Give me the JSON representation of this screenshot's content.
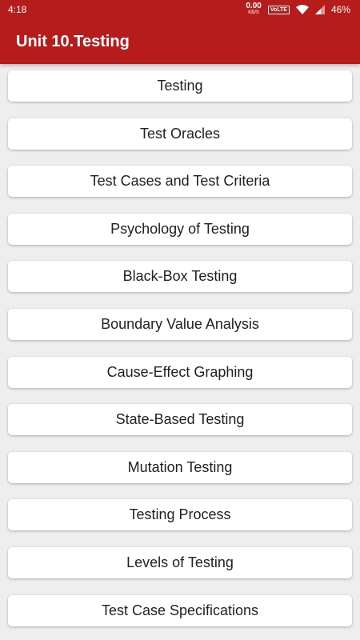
{
  "status_bar": {
    "time": "4:18",
    "net_speed_value": "0.00",
    "net_speed_unit": "KB/S",
    "volte_label": "VoLTE",
    "battery_text": "46%",
    "icons": [
      "wifi-icon",
      "signal-icon"
    ]
  },
  "app_bar": {
    "title": "Unit 10.Testing"
  },
  "colors": {
    "primary": "#b71c1c",
    "list_background": "#eeeeee",
    "card_background": "#ffffff",
    "card_text": "#212121"
  },
  "topics": [
    {
      "label": "Testing"
    },
    {
      "label": "Test Oracles"
    },
    {
      "label": "Test Cases and Test Criteria"
    },
    {
      "label": "Psychology of Testing"
    },
    {
      "label": "Black-Box Testing"
    },
    {
      "label": "Boundary Value Analysis"
    },
    {
      "label": "Cause-Effect Graphing"
    },
    {
      "label": "State-Based Testing"
    },
    {
      "label": "Mutation Testing"
    },
    {
      "label": "Testing Process"
    },
    {
      "label": "Levels of Testing"
    },
    {
      "label": "Test Case Specifications"
    }
  ]
}
